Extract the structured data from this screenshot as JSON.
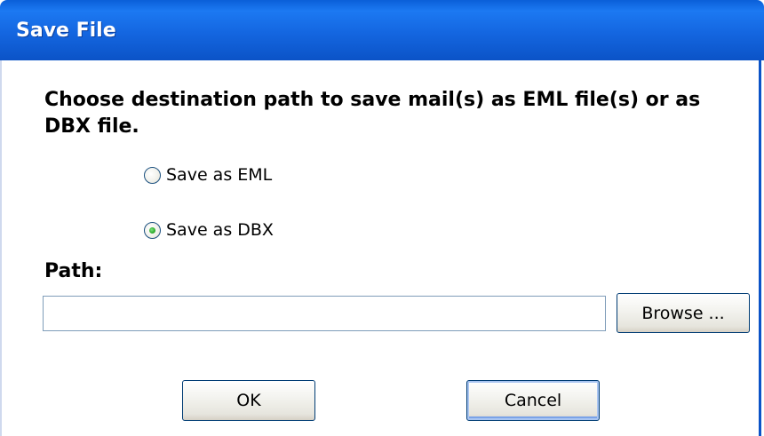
{
  "window": {
    "title": "Save File"
  },
  "dialog": {
    "instruction": "Choose destination path to save mail(s) as EML file(s) or as DBX file.",
    "options": [
      {
        "label": "Save as EML",
        "selected": false
      },
      {
        "label": "Save as DBX",
        "selected": true
      }
    ],
    "path_label": "Path:",
    "path_value": "",
    "browse_label": "Browse ...",
    "ok_label": "OK",
    "cancel_label": "Cancel"
  }
}
